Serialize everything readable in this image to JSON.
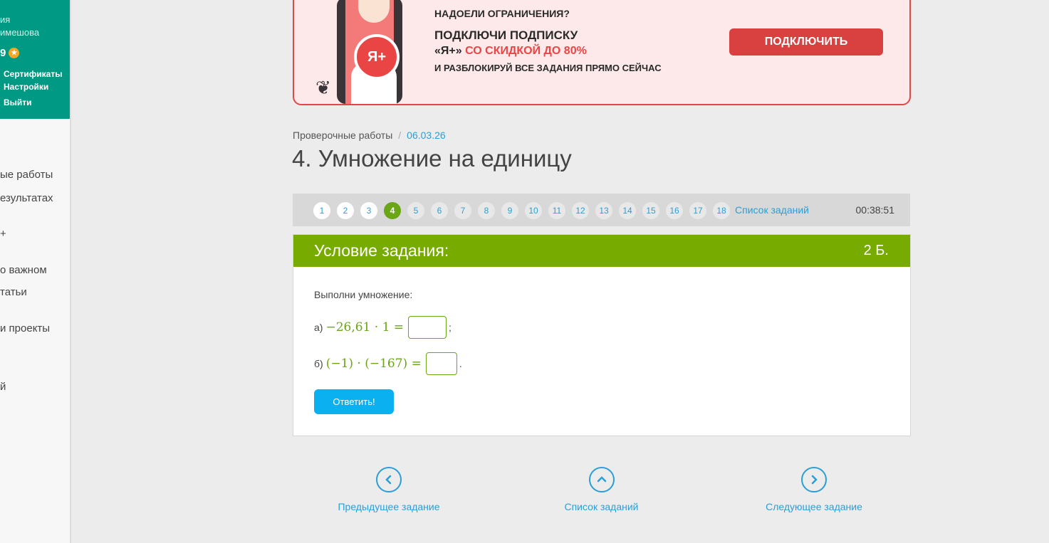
{
  "sidebar": {
    "profile_line1": "ия",
    "profile_line2": "имешова",
    "points": "9",
    "links": [
      "Сертификаты",
      "Настройки",
      "Выйти"
    ],
    "menu": [
      "ые работы",
      "езультатах",
      "+",
      "о важном",
      "татьи",
      " и проекты",
      "й"
    ]
  },
  "banner": {
    "line1": "НАДОЕЛИ ОГРАНИЧЕНИЯ?",
    "line2": "ПОДКЛЮЧИ ПОДПИСКУ",
    "line3_a": "«Я+»",
    "line3_b": "СО СКИДКОЙ ДО 80%",
    "line4": "И РАЗБЛОКИРУЙ ВСЕ ЗАДАНИЯ ПРЯМО СЕЙЧАС",
    "badge": "Я+",
    "button": "ПОДКЛЮЧИТЬ"
  },
  "breadcrumb": {
    "root": "Проверочные работы",
    "current": "06.03.26"
  },
  "title": "4. Умножение на единицу",
  "task_nav": {
    "numbers": [
      "1",
      "2",
      "3",
      "4",
      "5",
      "6",
      "7",
      "8",
      "9",
      "10",
      "11",
      "12",
      "13",
      "14",
      "15",
      "16",
      "17",
      "18"
    ],
    "active": "4",
    "list_link": "Список заданий",
    "timer": "00:38:51"
  },
  "task": {
    "header": "Условие задания:",
    "points": "2 Б.",
    "question": "Выполни умножение:",
    "a_label": "а)",
    "a_expr": "−26,61 · 1 =",
    "a_after": ";",
    "b_label": "б)",
    "b_expr": "(−1) · (−167) =",
    "b_after": ".",
    "submit": "Ответить!"
  },
  "bottom_nav": {
    "prev": "Предыдущее задание",
    "list": "Список заданий",
    "next": "Следующее задание"
  }
}
